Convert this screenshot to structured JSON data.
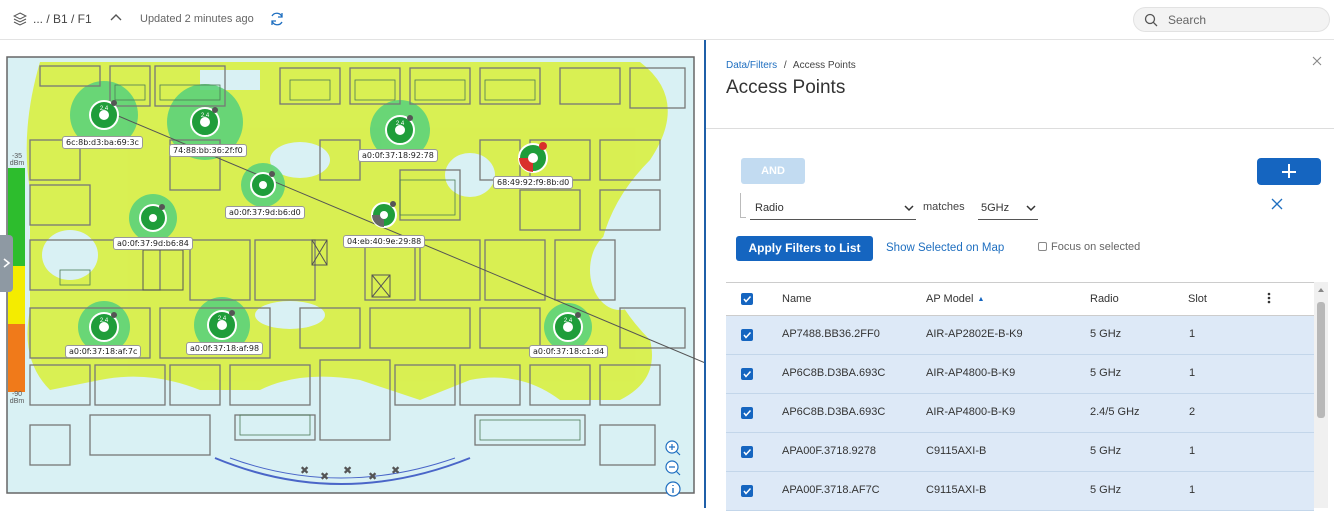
{
  "topbar": {
    "breadcrumb": "... / B1 / F1",
    "updated": "Updated 2 minutes ago",
    "search_placeholder": "Search"
  },
  "map": {
    "legend_top_value": "-35",
    "legend_top_unit": "dBm",
    "legend_bottom_value": "-90",
    "legend_bottom_unit": "dBm",
    "ap_labels": [
      "6c:8b:d3:ba:69:3c",
      "74:88:bb:36:2f:f0",
      "a0:0f:37:18:92:78",
      "68:49:92:f9:8b:d0",
      "a0:0f:37:9d:b6:d0",
      "a0:0f:37:9d:b6:84",
      "04:eb:40:9e:29:88",
      "a0:0f:37:18:af:7c",
      "a0:0f:37:18:af:98",
      "a0:0f:37:18:c1:d4"
    ]
  },
  "panel": {
    "breadcrumb_link": "Data/Filters",
    "breadcrumb_sep": "/",
    "breadcrumb_current": "Access Points",
    "title": "Access Points",
    "and_label": "AND",
    "filter_field": "Radio",
    "matches_label": "matches",
    "filter_value": "5GHz",
    "apply_label": "Apply Filters to List",
    "show_selected_label": "Show Selected on Map",
    "focus_label": "Focus on selected",
    "columns": {
      "name": "Name",
      "model": "AP Model",
      "radio": "Radio",
      "slot": "Slot"
    },
    "rows": [
      {
        "name": "AP7488.BB36.2FF0",
        "model": "AIR-AP2802E-B-K9",
        "radio": "5 GHz",
        "slot": "1"
      },
      {
        "name": "AP6C8B.D3BA.693C",
        "model": "AIR-AP4800-B-K9",
        "radio": "5 GHz",
        "slot": "1"
      },
      {
        "name": "AP6C8B.D3BA.693C",
        "model": "AIR-AP4800-B-K9",
        "radio": "2.4/5 GHz",
        "slot": "2"
      },
      {
        "name": "APA00F.3718.9278",
        "model": "C9115AXI-B",
        "radio": "5 GHz",
        "slot": "1"
      },
      {
        "name": "APA00F.3718.AF7C",
        "model": "C9115AXI-B",
        "radio": "5 GHz",
        "slot": "1"
      }
    ]
  },
  "colors": {
    "primary": "#1565c0",
    "heatmap_yellow": "#d9ef4a",
    "heatmap_green": "#5cd37a",
    "floor_bg": "#d9f1f4",
    "ap_green": "#1f9d3a",
    "ap_red": "#d9302c"
  }
}
